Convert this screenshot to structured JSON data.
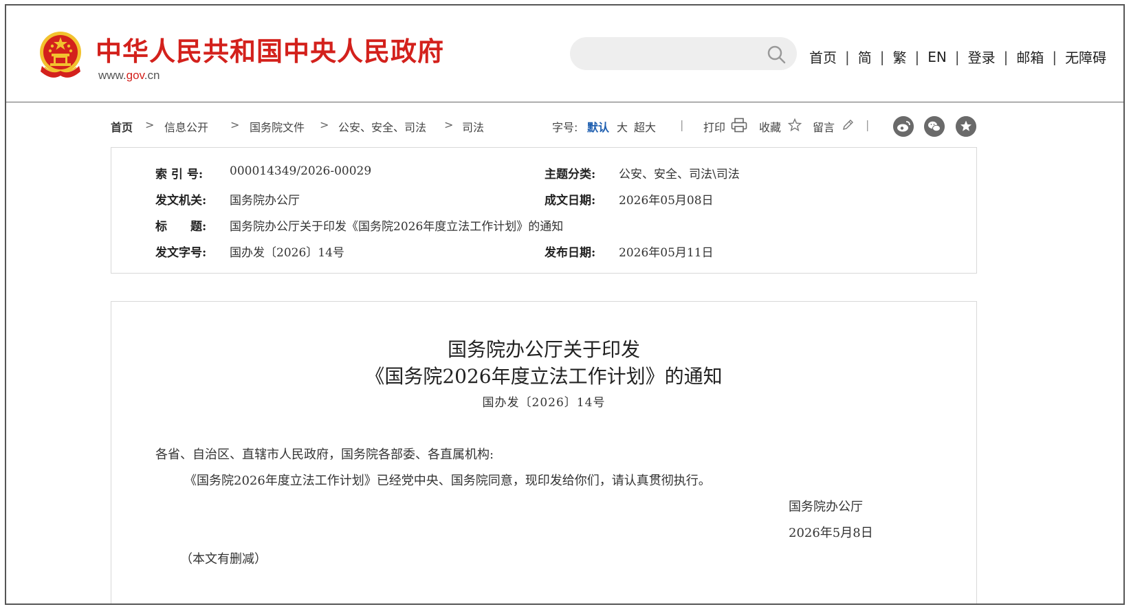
{
  "header": {
    "site_name": "中华人民共和国中央人民政府",
    "domain_prefix": "www.",
    "domain_mid": "gov",
    "domain_suffix": ".cn",
    "search_placeholder": "",
    "nav": [
      "首页",
      "简",
      "繁",
      "EN",
      "登录",
      "邮箱",
      "无障碍"
    ],
    "nav_separator": "|"
  },
  "breadcrumb": {
    "items": [
      "首页",
      "信息公开",
      "国务院文件",
      "公安、安全、司法",
      "司法"
    ],
    "separator": ">"
  },
  "tools": {
    "font_label": "字号:",
    "font_default": "默认",
    "font_large": "大",
    "font_xlarge": "超大",
    "separator": "|",
    "print": "打印",
    "favorite": "收藏",
    "comment": "留言"
  },
  "social": [
    "weibo-icon",
    "wechat-icon",
    "favorite-star-icon"
  ],
  "meta": {
    "index_label": "索 引 号:",
    "index_value": "000014349/2026-00029",
    "topic_label": "主题分类:",
    "topic_value": "公安、安全、司法\\司法",
    "issuer_label": "发文机关:",
    "issuer_value": "国务院办公厅",
    "written_label": "成文日期:",
    "written_value": "2026年05月08日",
    "title_label": "标　　题:",
    "title_value": "国务院办公厅关于印发《国务院2026年度立法工作计划》的通知",
    "docno_label": "发文字号:",
    "docno_value": "国办发〔2026〕14号",
    "published_label": "发布日期:",
    "published_value": "2026年05月11日"
  },
  "article": {
    "title_line1": "国务院办公厅关于印发",
    "title_line2": "《国务院2026年度立法工作计划》的通知",
    "doc_number": "国办发〔2026〕14号",
    "salutation": "各省、自治区、直辖市人民政府，国务院各部委、各直属机构:",
    "body": "《国务院2026年度立法工作计划》已经党中央、国务院同意，现印发给你们，请认真贯彻执行。",
    "signature": "国务院办公厅",
    "date": "2026年5月8日",
    "note": "（本文有删减）"
  },
  "colors": {
    "brand_red": "#d3211c",
    "link_blue": "#1f5fb0",
    "emblem_gold": "#f2c22e"
  }
}
